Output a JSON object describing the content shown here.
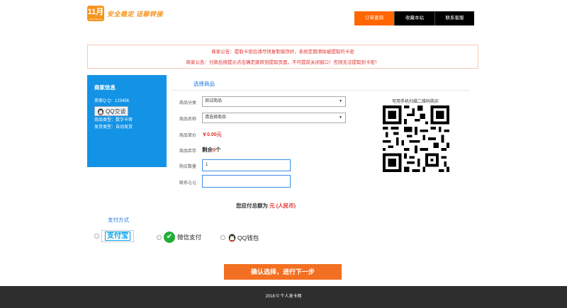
{
  "header": {
    "logo_mark": "11月",
    "logo_sub": "www.7dk.com",
    "slogan_a": "安全稳定",
    "slogan_b": "话聊转接",
    "nav": [
      "订单查询",
      "收藏本站",
      "联系客服"
    ]
  },
  "notice": {
    "line1": "商家公告：提取卡密后请尽快复制保存好，系统定期清除被提取的卡密",
    "line2": "商家公告：付款后按提示点击确定跳转到提取页面，不可提前关闭窗口！否则无法提取到卡密！"
  },
  "merchant": {
    "title": "商家信息",
    "qq_line": "卖家Q Q：123456",
    "qq_button": "QQ交谈",
    "type_line": "商品类型：数字卡密",
    "ship_line": "发货类型：自动发货"
  },
  "form": {
    "section_title": "选择商品",
    "category_label": "商品分类",
    "category_value": "测试商品",
    "name_label": "商品名称",
    "name_value": "请选择商品",
    "price_label": "商品单价",
    "price_value": "￥0.00元",
    "stock_label": "商品库存",
    "stock_prefix": "剩余",
    "stock_count": "0",
    "stock_suffix": "个",
    "qty_label": "购买数量",
    "qty_value": "1",
    "contact_label": "联系ＱＱ",
    "contact_value": ""
  },
  "qr": {
    "caption": "可用手机扫描二维码购买"
  },
  "total": {
    "prefix": "您应付总额为",
    "amount": "",
    "unit": "元",
    "currency": "(人民币)"
  },
  "payment": {
    "title": "支付方式",
    "alipay": "支付宝",
    "wechat": "微信支付",
    "qqwallet": "QQ钱包"
  },
  "confirm_button": "确认选择，进行下一步",
  "footer": "2018 © 个人发卡网",
  "colors": {
    "accent": "#f36f21",
    "merchant_bg": "#1393e6",
    "link_blue": "#1a73d9",
    "notice_red": "#e0312d",
    "footer_bg": "#2e2e2e"
  }
}
